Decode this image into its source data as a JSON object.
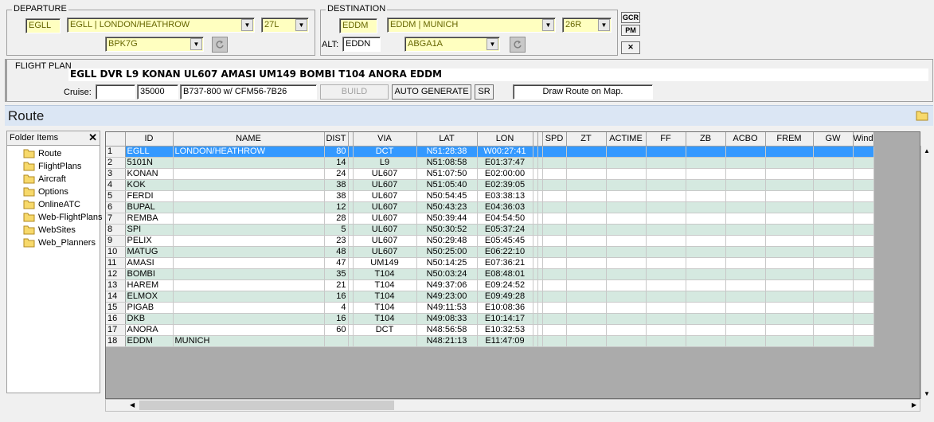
{
  "departure": {
    "legend": "DEPARTURE",
    "icao": "EGLL",
    "airport": "EGLL | LONDON/HEATHROW",
    "runway": "27L",
    "sid": "BPK7G"
  },
  "destination": {
    "legend": "DESTINATION",
    "icao": "EDDM",
    "airport": "EDDM | MUNICH",
    "runway": "26R",
    "star": "ABGA1A",
    "alt_label": "ALT:",
    "alt_value": "EDDN"
  },
  "side_buttons": {
    "gcr": "GCR",
    "pm": "PM",
    "close": "✕"
  },
  "flight_plan": {
    "legend": "FLIGHT PLAN",
    "route_string": "EGLL DVR L9 KONAN UL607 AMASI UM149 BOMBI T104 ANORA EDDM",
    "cruise_label": "Cruise:",
    "cruise_value": "",
    "altitude": "35000",
    "aircraft": "B737-800 w/ CFM56-7B26",
    "build_label": "BUILD",
    "auto_label": "AUTO GENERATE",
    "sr_label": "SR",
    "draw_label": "Draw Route on Map."
  },
  "route_panel": {
    "title": "Route"
  },
  "folder_panel": {
    "header": "Folder Items",
    "close": "✕",
    "items": [
      "Route",
      "FlightPlans",
      "Aircraft",
      "Options",
      "OnlineATC",
      "Web-FlightPlans",
      "WebSites",
      "Web_Planners"
    ]
  },
  "grid": {
    "columns": [
      "ID",
      "NAME",
      "DIST",
      "VIA",
      "LAT",
      "LON",
      "SPD",
      "ZT",
      "ACTIME",
      "FF",
      "ZB",
      "ACBO",
      "FREM",
      "GW",
      "Wind"
    ],
    "rows": [
      [
        "1",
        "EGLL",
        "LONDON/HEATHROW",
        "80",
        "DCT",
        "N51:28:38",
        "W00:27:41"
      ],
      [
        "2",
        "5101N",
        "",
        "14",
        "L9",
        "N51:08:58",
        "E01:37:47"
      ],
      [
        "3",
        "KONAN",
        "",
        "24",
        "UL607",
        "N51:07:50",
        "E02:00:00"
      ],
      [
        "4",
        "KOK",
        "",
        "38",
        "UL607",
        "N51:05:40",
        "E02:39:05"
      ],
      [
        "5",
        "FERDI",
        "",
        "38",
        "UL607",
        "N50:54:45",
        "E03:38:13"
      ],
      [
        "6",
        "BUPAL",
        "",
        "12",
        "UL607",
        "N50:43:23",
        "E04:36:03"
      ],
      [
        "7",
        "REMBA",
        "",
        "28",
        "UL607",
        "N50:39:44",
        "E04:54:50"
      ],
      [
        "8",
        "SPI",
        "",
        "5",
        "UL607",
        "N50:30:52",
        "E05:37:24"
      ],
      [
        "9",
        "PELIX",
        "",
        "23",
        "UL607",
        "N50:29:48",
        "E05:45:45"
      ],
      [
        "10",
        "MATUG",
        "",
        "48",
        "UL607",
        "N50:25:00",
        "E06:22:10"
      ],
      [
        "11",
        "AMASI",
        "",
        "47",
        "UM149",
        "N50:14:25",
        "E07:36:21"
      ],
      [
        "12",
        "BOMBI",
        "",
        "35",
        "T104",
        "N50:03:24",
        "E08:48:01"
      ],
      [
        "13",
        "HAREM",
        "",
        "21",
        "T104",
        "N49:37:06",
        "E09:24:52"
      ],
      [
        "14",
        "ELMOX",
        "",
        "16",
        "T104",
        "N49:23:00",
        "E09:49:28"
      ],
      [
        "15",
        "PIGAB",
        "",
        "4",
        "T104",
        "N49:11:53",
        "E10:08:36"
      ],
      [
        "16",
        "DKB",
        "",
        "16",
        "T104",
        "N49:08:33",
        "E10:14:17"
      ],
      [
        "17",
        "ANORA",
        "",
        "60",
        "DCT",
        "N48:56:58",
        "E10:32:53"
      ],
      [
        "18",
        "EDDM",
        "MUNICH",
        "",
        "",
        "N48:21:13",
        "E11:47:09"
      ]
    ],
    "selected_row": 0
  },
  "colors": {
    "selection": "#3399ff",
    "row_alt": "#d5e9e0",
    "yellow_field": "#ffffc0",
    "route_band": "#dbe6f4"
  }
}
